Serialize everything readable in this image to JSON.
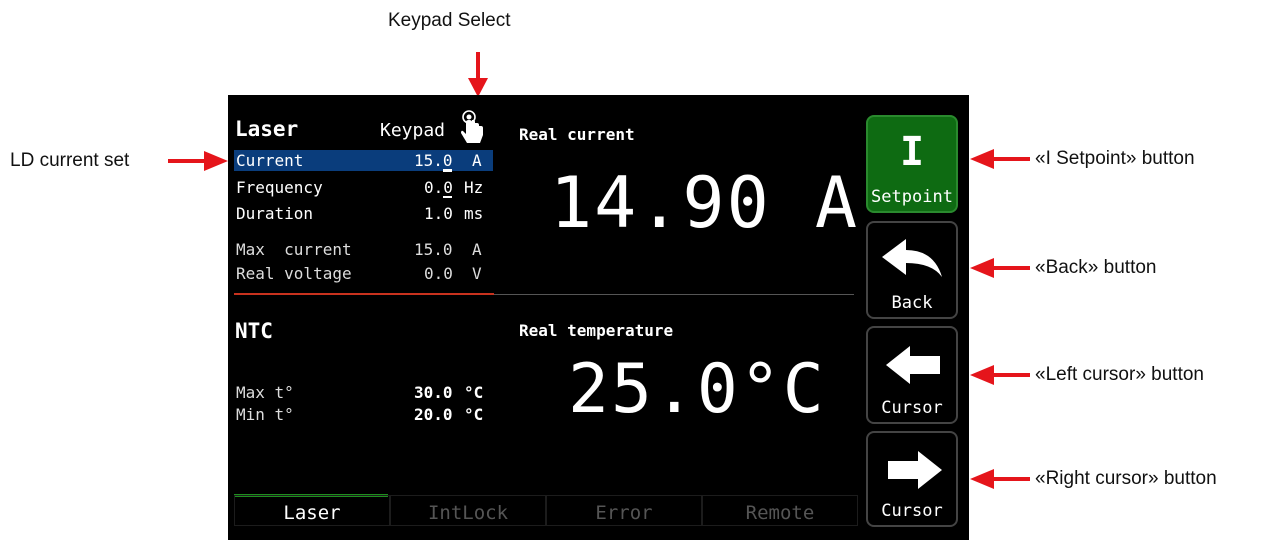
{
  "annotations": {
    "keypad_select": "Keypad Select",
    "ld_current_set": "LD current set",
    "i_setpoint_button": "«I Setpoint» button",
    "back_button": "«Back» button",
    "left_cursor_button": "«Left cursor» button",
    "right_cursor_button": "«Right cursor» button"
  },
  "laser": {
    "title": "Laser",
    "mode": "Keypad",
    "params": [
      {
        "label": "Current",
        "value": "15.0",
        "unit": "A"
      },
      {
        "label": "Frequency",
        "value": "0.0",
        "unit": "Hz"
      },
      {
        "label": "Duration",
        "value": "1.0",
        "unit": "ms"
      }
    ],
    "info": [
      {
        "label": "Max  current",
        "value": "15.0",
        "unit": "A"
      },
      {
        "label": "Real voltage",
        "value": "0.0",
        "unit": "V"
      }
    ],
    "real_current_label": "Real current",
    "real_current_value": "14.90 A"
  },
  "ntc": {
    "title": "NTC",
    "params": [
      {
        "label": "Max t°",
        "value": "30.0",
        "unit": "°C"
      },
      {
        "label": "Min t°",
        "value": "20.0",
        "unit": "°C"
      }
    ],
    "real_temp_label": "Real temperature",
    "real_temp_value": "25.0°C"
  },
  "buttons": {
    "setpoint_symbol": "I",
    "setpoint_label": "Setpoint",
    "back_label": "Back",
    "left_cursor_label": "Cursor",
    "right_cursor_label": "Cursor"
  },
  "tabs": [
    "Laser",
    "IntLock",
    "Error",
    "Remote"
  ],
  "colors": {
    "selection": "#0a3d7c",
    "setpoint_button": "#0e6b12",
    "divider": "#c8321e",
    "active_tab": "#1e8f1e",
    "arrow": "#e5151b"
  }
}
